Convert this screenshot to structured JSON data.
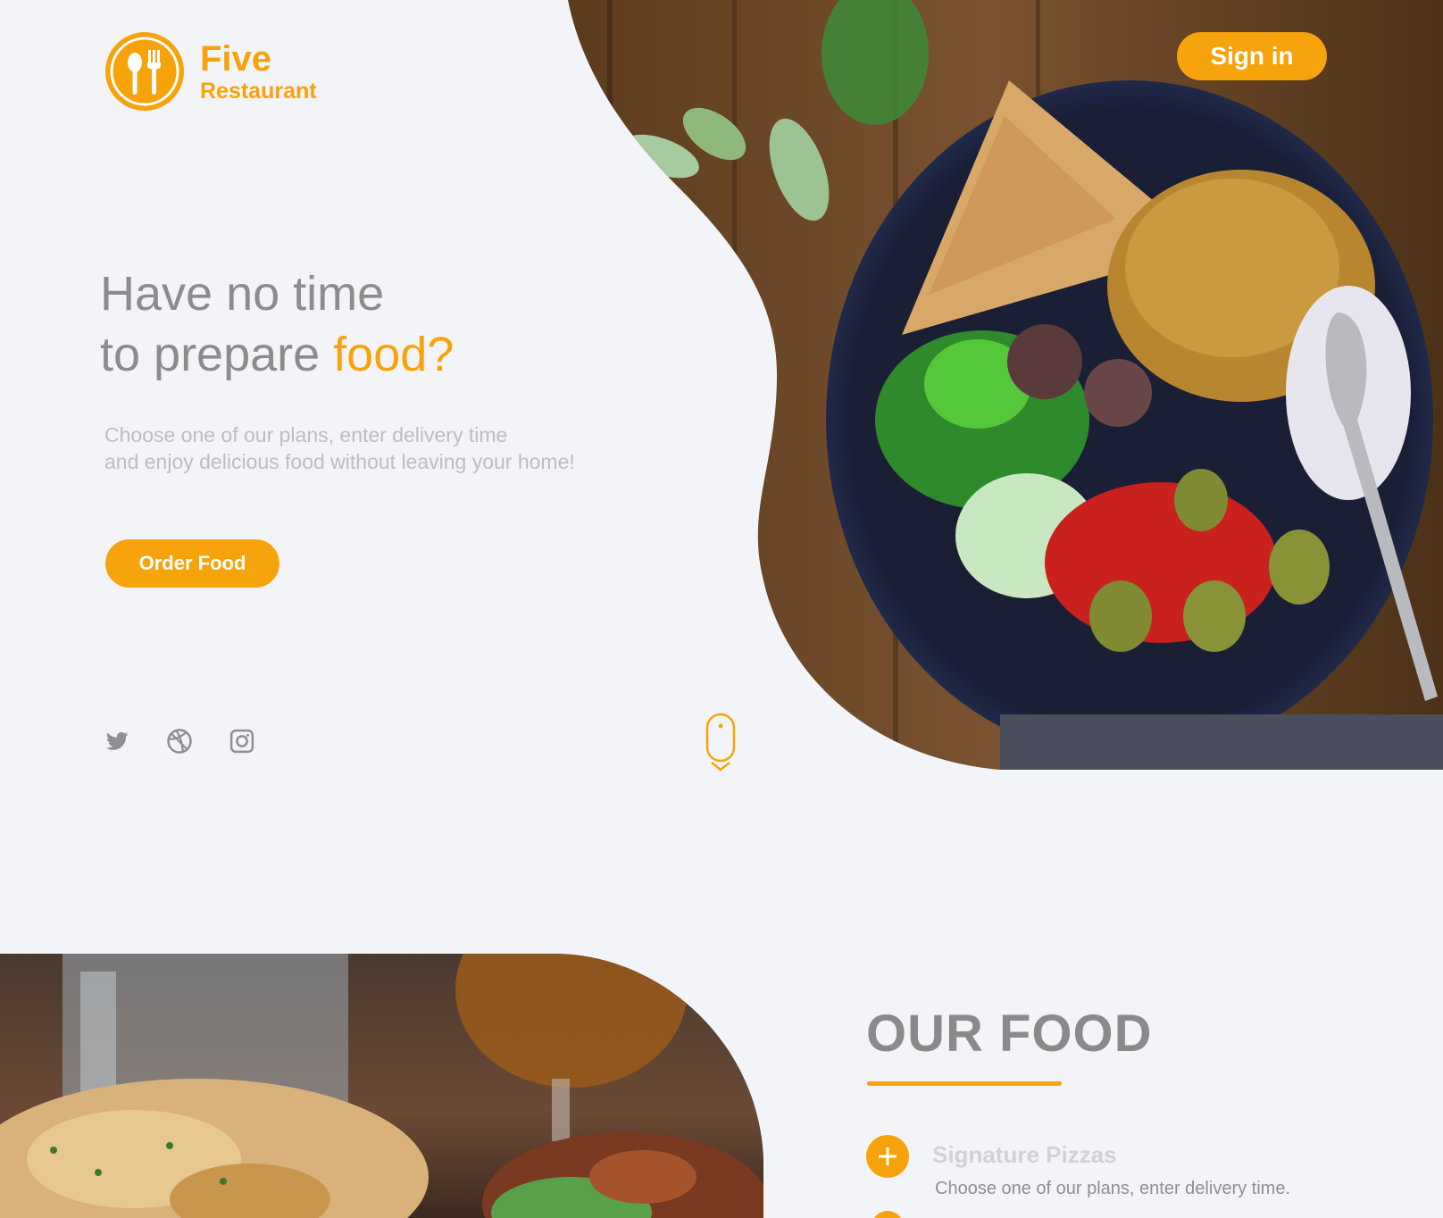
{
  "brand": {
    "name": "Five",
    "subtitle": "Restaurant",
    "accent_color": "#f7a30b"
  },
  "header": {
    "signin_label": "Sign in"
  },
  "hero": {
    "headline_line1": "Have no time",
    "headline_line2_prefix": "to prepare ",
    "headline_line2_accent": "food?",
    "subtext_line1": "Choose one of our plans, enter delivery time",
    "subtext_line2": "and enjoy delicious food without leaving your home!",
    "cta_label": "Order Food"
  },
  "social": [
    {
      "icon": "twitter-icon"
    },
    {
      "icon": "dribbble-icon"
    },
    {
      "icon": "instagram-icon"
    }
  ],
  "scroll_indicator": {
    "icon": "scroll-mouse-icon"
  },
  "our_food": {
    "title": "OUR FOOD",
    "items": [
      {
        "title": "Signature Pizzas",
        "description": "Choose one of our plans, enter delivery time."
      }
    ]
  }
}
